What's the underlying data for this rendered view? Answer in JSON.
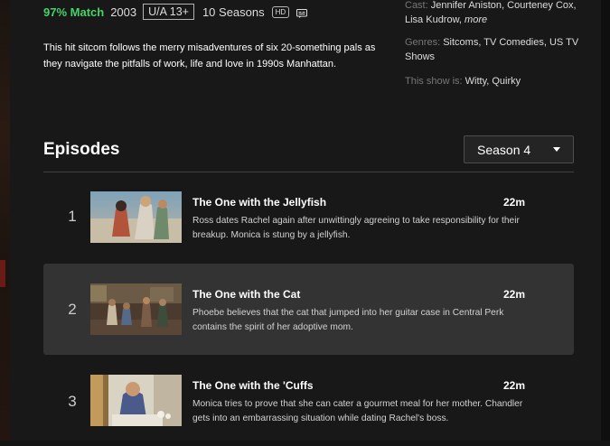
{
  "meta": {
    "match": "97% Match",
    "year": "2003",
    "rating": "U/A 13+",
    "seasons": "10 Seasons",
    "hd": "HD",
    "subtitle_icon": "subtitles-icon"
  },
  "synopsis": "This hit sitcom follows the merry misadventures of six 20-something pals as they navigate the pitfalls of work, life and love in 1990s Manhattan.",
  "details": {
    "cast_label": "Cast:",
    "cast_value": "Jennifer Aniston, Courteney Cox, Lisa Kudrow,",
    "cast_more": "more",
    "genres_label": "Genres:",
    "genres_value": "Sitcoms, TV Comedies, US TV Shows",
    "tags_label": "This show is:",
    "tags_value": "Witty, Quirky"
  },
  "episodes_section": {
    "title": "Episodes",
    "season_selected": "Season 4"
  },
  "episodes": [
    {
      "number": "1",
      "title": "The One with the Jellyfish",
      "duration": "22m",
      "description": "Ross dates Rachel again after unwittingly agreeing to take responsibility for their breakup. Monica is stung by a jellyfish."
    },
    {
      "number": "2",
      "title": "The One with the Cat",
      "duration": "22m",
      "description": "Phoebe believes that the cat that jumped into her guitar case in Central Perk contains the spirit of her adoptive mom."
    },
    {
      "number": "3",
      "title": "The One with the 'Cuffs",
      "duration": "22m",
      "description": "Monica tries to prove that she can cater a gourmet meal for her mother. Chandler gets into an embarrassing situation while dating Rachel's boss."
    }
  ],
  "colors": {
    "match": "#46d369",
    "background": "#181818",
    "active_row": "#333333"
  }
}
